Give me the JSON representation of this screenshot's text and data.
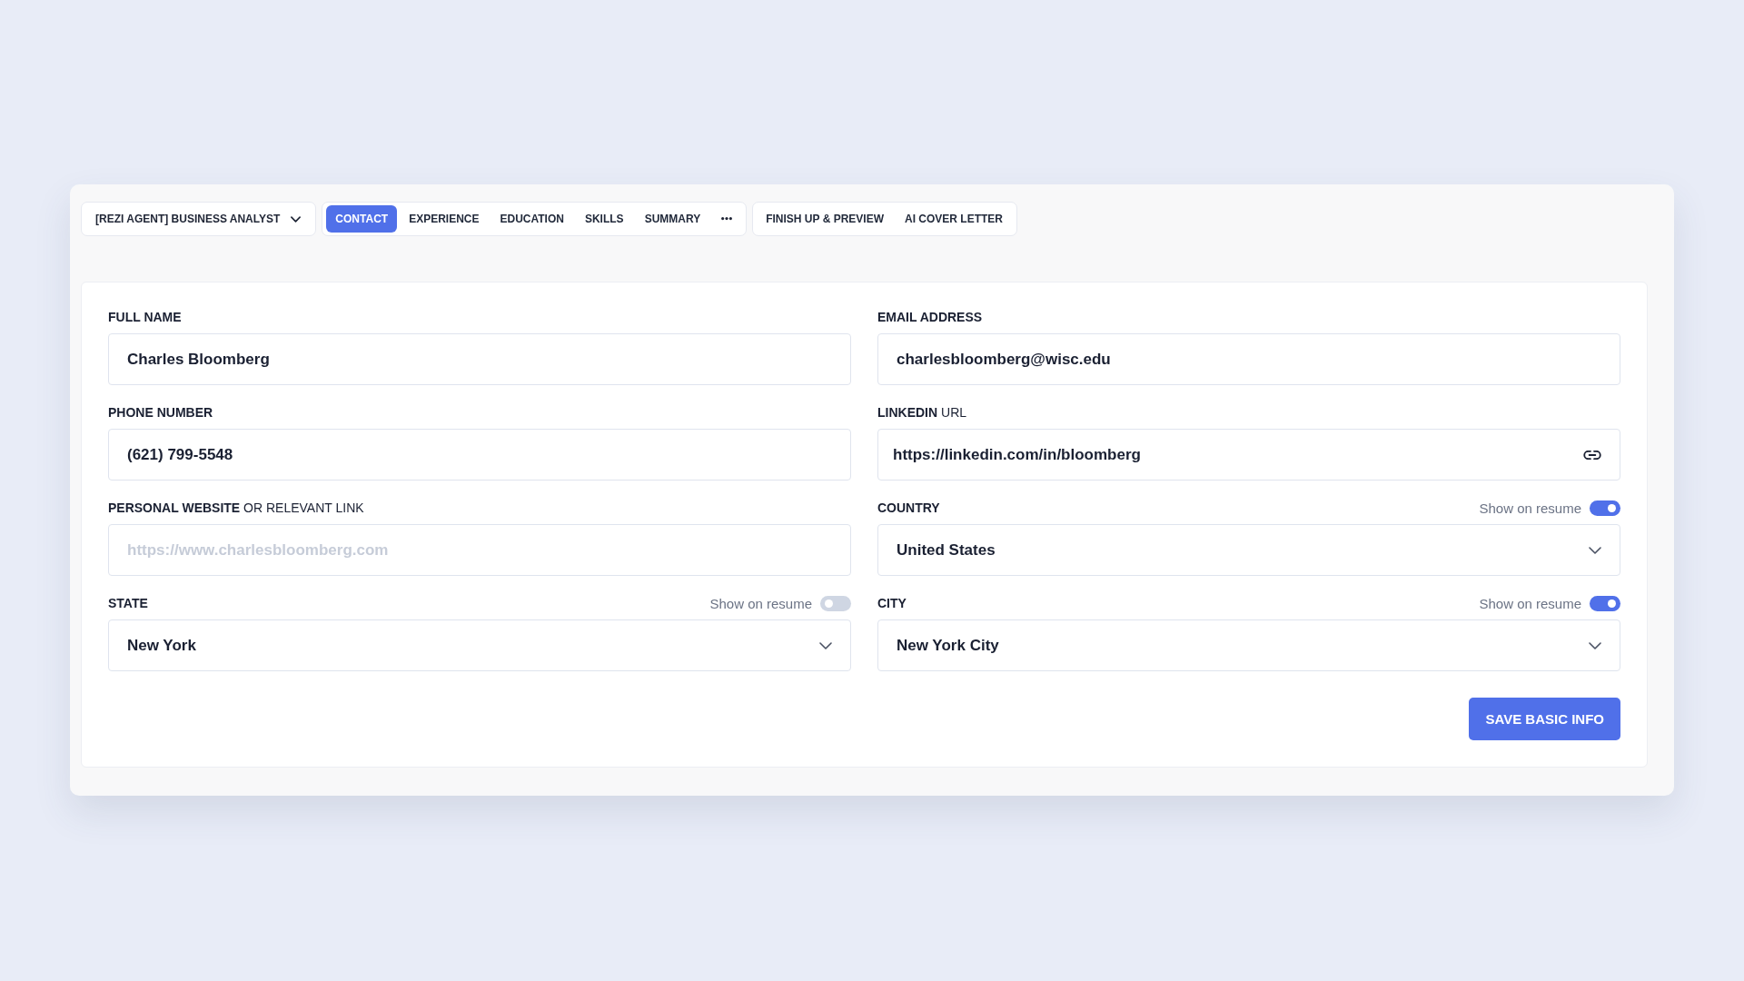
{
  "resume_selector": {
    "label": "[REZI AGENT] BUSINESS ANALYST"
  },
  "tabs": [
    {
      "label": "CONTACT",
      "selected": true
    },
    {
      "label": "EXPERIENCE",
      "selected": false
    },
    {
      "label": "EDUCATION",
      "selected": false
    },
    {
      "label": "SKILLS",
      "selected": false
    },
    {
      "label": "SUMMARY",
      "selected": false
    }
  ],
  "extra_tabs": [
    {
      "label": "FINISH UP & PREVIEW",
      "selected": false
    },
    {
      "label": "AI COVER LETTER",
      "selected": false
    }
  ],
  "form": {
    "fields": [
      {
        "label": "FULL NAME",
        "kind": "text",
        "value": "Charles Bloomberg"
      },
      {
        "label": "EMAIL ADDRESS",
        "kind": "text",
        "value": "charlesbloomberg@wisc.edu"
      },
      {
        "label": "PHONE NUMBER",
        "kind": "text",
        "value": "(621) 799-5548"
      },
      {
        "label": "LINKEDIN",
        "label_note": "URL",
        "kind": "link",
        "value": "https://linkedin.com/in/bloomberg"
      },
      {
        "label": "PERSONAL WEBSITE",
        "label_note": "OR RELEVANT LINK",
        "kind": "text",
        "placeholder": "https://www.charlesbloomberg.com"
      },
      {
        "label": "COUNTRY",
        "kind": "select",
        "value": "United States",
        "show_on_resume": {
          "label": "Show on resume",
          "on": true
        }
      },
      {
        "label": "STATE",
        "kind": "select",
        "value": "New York",
        "show_on_resume": {
          "label": "Show on resume",
          "on": false
        }
      },
      {
        "label": "CITY",
        "kind": "select",
        "value": "New York City",
        "show_on_resume": {
          "label": "Show on resume",
          "on": true
        }
      }
    ],
    "save_button": "SAVE BASIC INFO"
  }
}
